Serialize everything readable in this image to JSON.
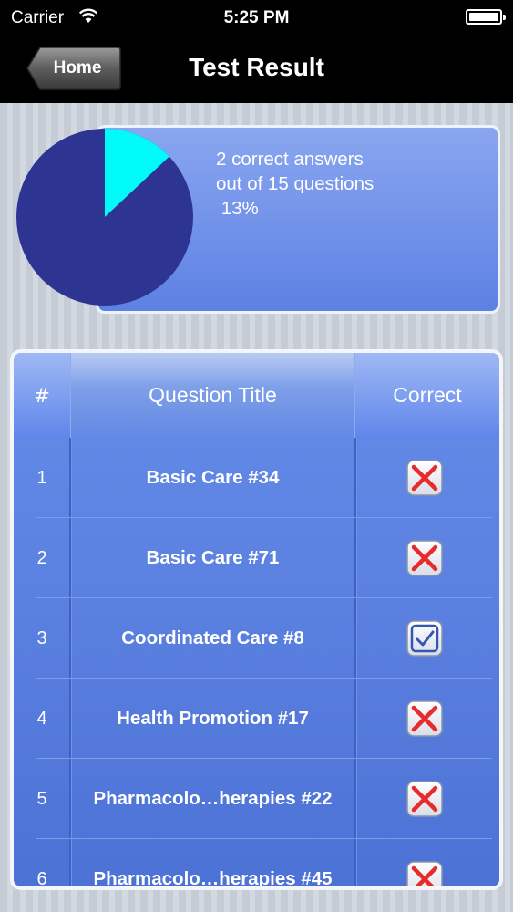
{
  "status_bar": {
    "carrier": "Carrier",
    "time": "5:25 PM"
  },
  "nav": {
    "back_label": "Home",
    "title": "Test Result"
  },
  "summary": {
    "line1": "2 correct answers",
    "line2": "out of 15 questions",
    "line3": " 13%",
    "correct_fraction": 0.13,
    "pie_colors": {
      "correct": "#00fbfb",
      "incorrect": "#2e3492"
    }
  },
  "table": {
    "headers": {
      "number": "#",
      "title": "Question Title",
      "correct": "Correct"
    },
    "rows": [
      {
        "number": "1",
        "title": "Basic Care #34",
        "correct": false
      },
      {
        "number": "2",
        "title": "Basic Care #71",
        "correct": false
      },
      {
        "number": "3",
        "title": "Coordinated Care #8",
        "correct": true
      },
      {
        "number": "4",
        "title": "Health Promotion #17",
        "correct": false
      },
      {
        "number": "5",
        "title": "Pharmacolo…herapies #22",
        "correct": false
      },
      {
        "number": "6",
        "title": "Pharmacolo…herapies #45",
        "correct": false
      }
    ]
  },
  "colors": {
    "accent": "#5a80df",
    "wrong_mark": "#e82a2a",
    "check_mark": "#3557b0"
  }
}
